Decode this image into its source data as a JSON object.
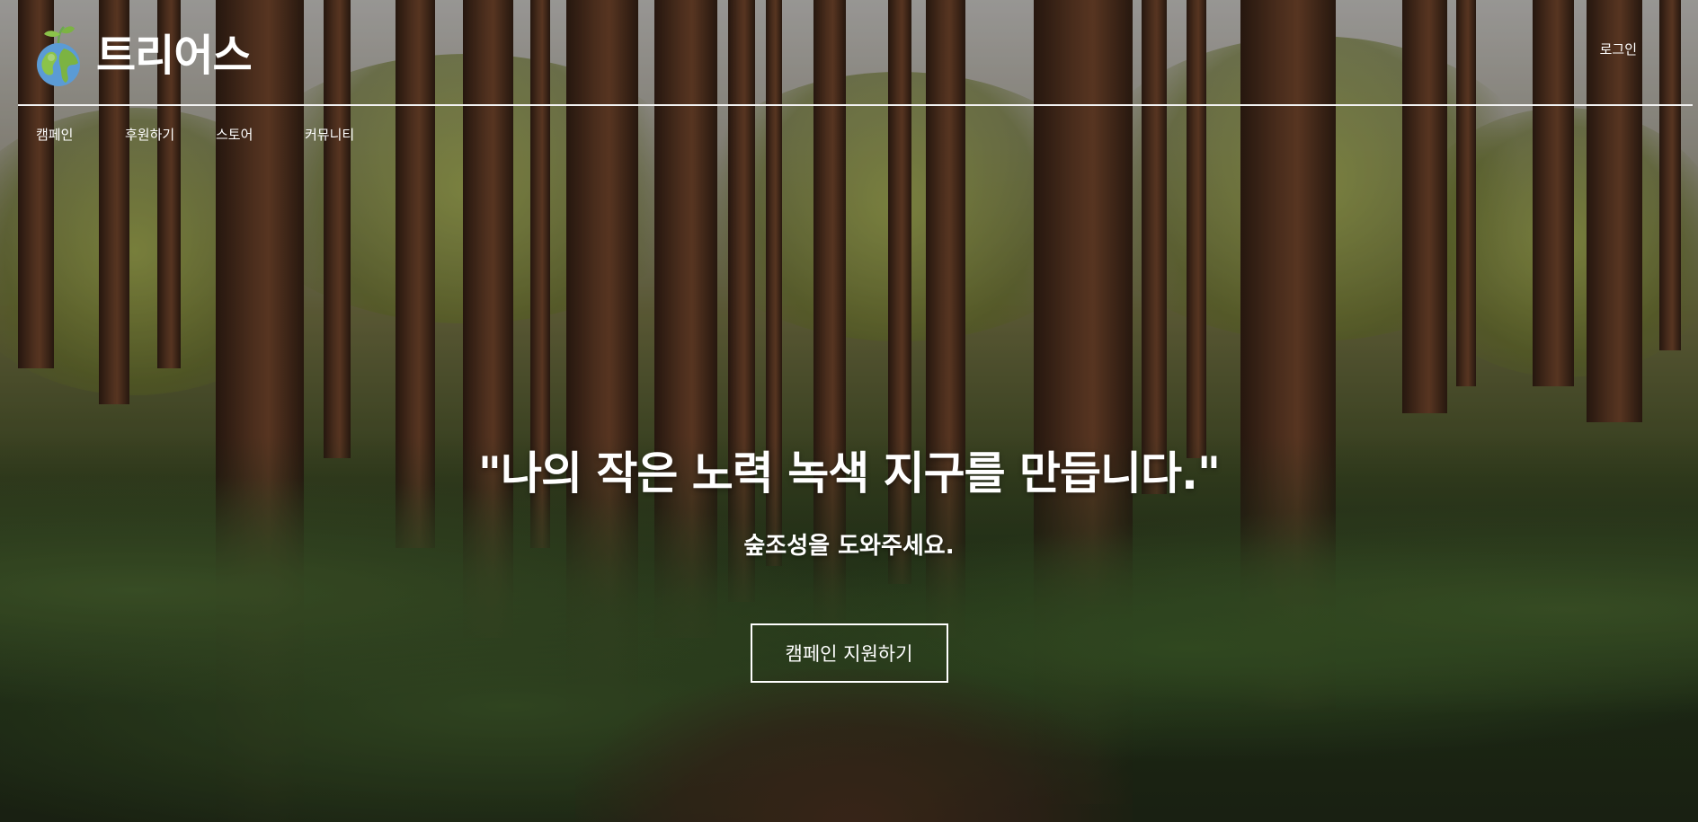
{
  "brand": {
    "name": "트리어스",
    "logo_icon": "globe-sprout-icon"
  },
  "header": {
    "login_label": "로그인"
  },
  "nav": {
    "items": [
      {
        "label": "캠페인"
      },
      {
        "label": "후원하기"
      },
      {
        "label": "스토어"
      },
      {
        "label": "커뮤니티"
      }
    ]
  },
  "hero": {
    "headline": "\"나의 작은 노력 녹색 지구를 만듭니다.\"",
    "subline": "숲조성을 도와주세요.",
    "cta_label": "캠페인 지원하기"
  },
  "colors": {
    "text": "#ffffff",
    "divider": "#f2f2f2"
  }
}
